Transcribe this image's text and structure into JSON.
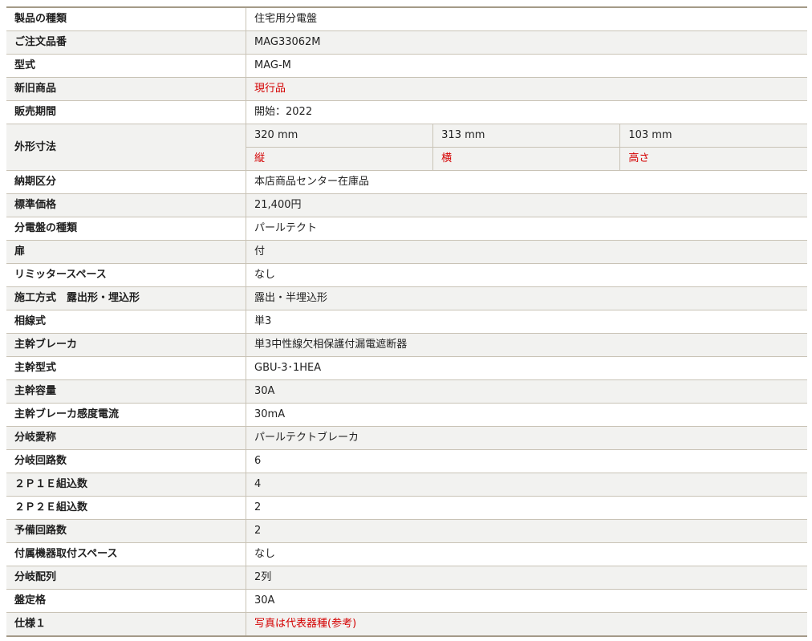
{
  "spec": {
    "rows": [
      {
        "label": "製品の種類",
        "value": "住宅用分電盤"
      },
      {
        "label": "ご注文品番",
        "value": "MAG33062M"
      },
      {
        "label": "型式",
        "value": "MAG-M"
      },
      {
        "label": "新旧商品",
        "value": "現行品"
      },
      {
        "label": "販売期間",
        "value": "開始：2022"
      },
      {
        "label": "外形寸法"
      },
      {
        "label": "納期区分",
        "value": "本店商品センター在庫品"
      },
      {
        "label": "標準価格",
        "value": "21,400円"
      },
      {
        "label": "分電盤の種類",
        "value": "パールテクト"
      },
      {
        "label": "扉",
        "value": "付"
      },
      {
        "label": "リミッタースペース",
        "value": "なし"
      },
      {
        "label": "施工方式　露出形・埋込形",
        "value": "露出・半埋込形"
      },
      {
        "label": "相線式",
        "value": "単3"
      },
      {
        "label": "主幹ブレーカ",
        "value": "単3中性線欠相保護付漏電遮断器"
      },
      {
        "label": "主幹型式",
        "value": "GBU-3･1HEA"
      },
      {
        "label": "主幹容量",
        "value": "30A"
      },
      {
        "label": "主幹ブレーカ感度電流",
        "value": "30mA"
      },
      {
        "label": "分岐愛称",
        "value": "パールテクトブレーカ"
      },
      {
        "label": "分岐回路数",
        "value": "6"
      },
      {
        "label": "２Ｐ１Ｅ組込数",
        "value": "4"
      },
      {
        "label": "２Ｐ２Ｅ組込数",
        "value": "2"
      },
      {
        "label": "予備回路数",
        "value": "2"
      },
      {
        "label": "付属機器取付スペース",
        "value": "なし"
      },
      {
        "label": "分岐配列",
        "value": "2列"
      },
      {
        "label": "盤定格",
        "value": "30A"
      },
      {
        "label": "仕様１",
        "value": "写真は代表器種(参考)"
      }
    ],
    "dimensions": {
      "values": [
        "320 mm",
        "313 mm",
        "103 mm"
      ],
      "labels": [
        "縦",
        "横",
        "高さ"
      ]
    }
  },
  "colors": {
    "accent_red": "#d40000",
    "stripe": "#f2f2f0",
    "border": "#c9c3b6"
  }
}
